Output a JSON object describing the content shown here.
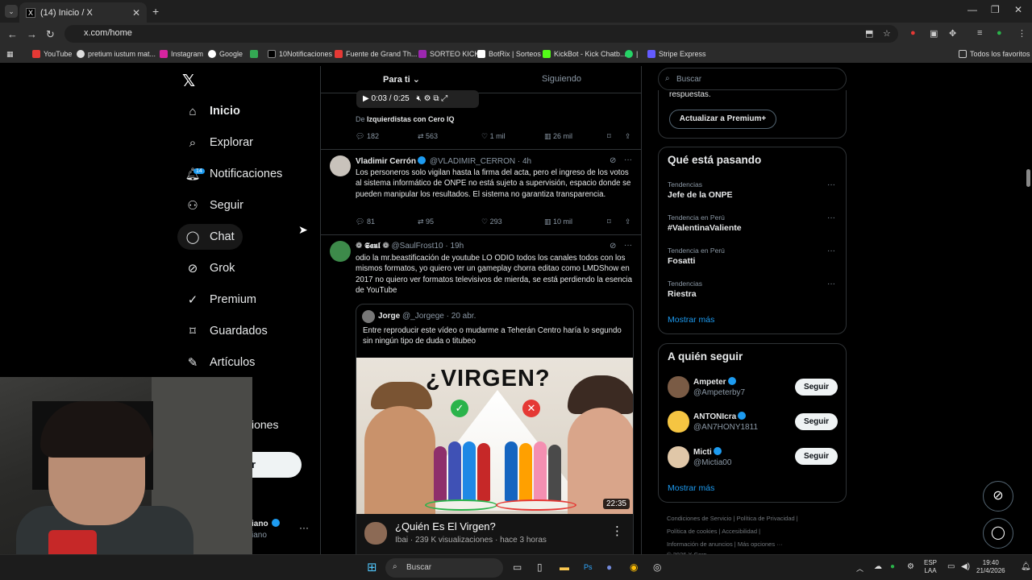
{
  "browser": {
    "tab_title": "(14) Inicio / X",
    "url": "x.com/home",
    "bookmarks": [
      "YouTube",
      "pretium iustum mat...",
      "Instagram",
      "Google",
      "10Notificaciones",
      "Fuente de Grand Th...",
      "SORTEO KICK",
      "BotRix | Sorteos",
      "KickBot - Kick Chatb...",
      "Stripe Express"
    ],
    "bookmarks_right": "Todos los favoritos"
  },
  "sidebar": {
    "items": [
      {
        "label": "Inicio",
        "icon": "home-icon"
      },
      {
        "label": "Explorar",
        "icon": "search-icon"
      },
      {
        "label": "Notificaciones",
        "icon": "bell-icon",
        "badge": "14"
      },
      {
        "label": "Seguir",
        "icon": "follow-icon"
      },
      {
        "label": "Chat",
        "icon": "chat-icon"
      },
      {
        "label": "Grok",
        "icon": "grok-icon"
      },
      {
        "label": "Premium",
        "icon": "premium-icon"
      },
      {
        "label": "Guardados",
        "icon": "bookmark-icon"
      },
      {
        "label": "Artículos",
        "icon": "articles-icon"
      }
    ],
    "partial_item": "iones",
    "partial_button": "r",
    "account_name_partial": "iano",
    "account_handle_partial": "iano"
  },
  "feed": {
    "tabs": [
      "Para ti",
      "Siguiendo"
    ],
    "prev_tweet": {
      "player_time": "0:03 / 0:25",
      "via_prefix": "De",
      "via_source": "Izquierdistas con Cero IQ",
      "replies": "182",
      "reposts": "563",
      "likes": "1 mil",
      "views": "26 mil"
    },
    "tweet1": {
      "name": "Vladimir Cerrón",
      "handle": "@VLADIMIR_CERRON",
      "time": "· 4h",
      "text": "Los personeros solo vigilan hasta la firma del acta, pero el ingreso de los votos al sistema informático de ONPE no está sujeto a supervisión, espacio donde se pueden manipular los resultados. El sistema no garantiza transparencia.",
      "replies": "81",
      "reposts": "95",
      "likes": "293",
      "views": "10 mil"
    },
    "tweet2": {
      "name": "❁ 𝕾𝖆𝖚𝖑 ❁",
      "handle": "@SaulFrost10",
      "time": "· 19h",
      "text": "odio la mr.beastificación de youtube LO ODIO todos los canales todos con los mismos formatos, yo quiero ver un gameplay chorra editao como LMDShow en 2017 no quiero ver formatos televisivos de mierda, se está perdiendo la esencia de YouTube",
      "quote": {
        "name": "Jorge",
        "handle": "@_Jorgege",
        "time": "· 20 abr.",
        "text": "Entre reproducir este vídeo o mudarme a Teherán Centro haría lo segundo sin ningún tipo de duda o titubeo",
        "thumb_title": "¿VIRGEN?",
        "duration": "22:35",
        "video_title": "¿Quién Es El Virgen?",
        "video_meta": "Ibai · 239 K visualizaciones · hace 3 horas"
      }
    }
  },
  "right": {
    "search_placeholder": "Buscar",
    "premium_text": "respuestas.",
    "premium_button": "Actualizar a Premium+",
    "trends_title": "Qué está pasando",
    "trends": [
      {
        "meta": "Tendencias",
        "name": "Jefe de la ONPE"
      },
      {
        "meta": "Tendencia en Perú",
        "name": "#ValentinaValiente"
      },
      {
        "meta": "Tendencia en Perú",
        "name": "Fosatti"
      },
      {
        "meta": "Tendencias",
        "name": "Riestra"
      }
    ],
    "show_more": "Mostrar más",
    "follow_title": "A quién seguir",
    "follow": [
      {
        "name": "Ampeter",
        "handle": "@Ampeterby7",
        "button": "Seguir"
      },
      {
        "name": "ANTONIcra",
        "handle": "@AN7HONY1811",
        "button": "Seguir"
      },
      {
        "name": "Micti",
        "handle": "@Mictia00",
        "button": "Seguir"
      }
    ],
    "show_more2": "Mostrar más",
    "footer1": "Condiciones de Servicio  |   Política de Privacidad  |",
    "footer2": "Política de cookies  |   Accesibilidad  |",
    "footer3": "Información de anuncios  |   Más opciones ···",
    "footer4": "© 2026 X Corp."
  },
  "taskbar": {
    "search": "Buscar",
    "lang1": "ESP",
    "lang2": "LAA",
    "time": "19:40",
    "date": "21/4/2026"
  }
}
